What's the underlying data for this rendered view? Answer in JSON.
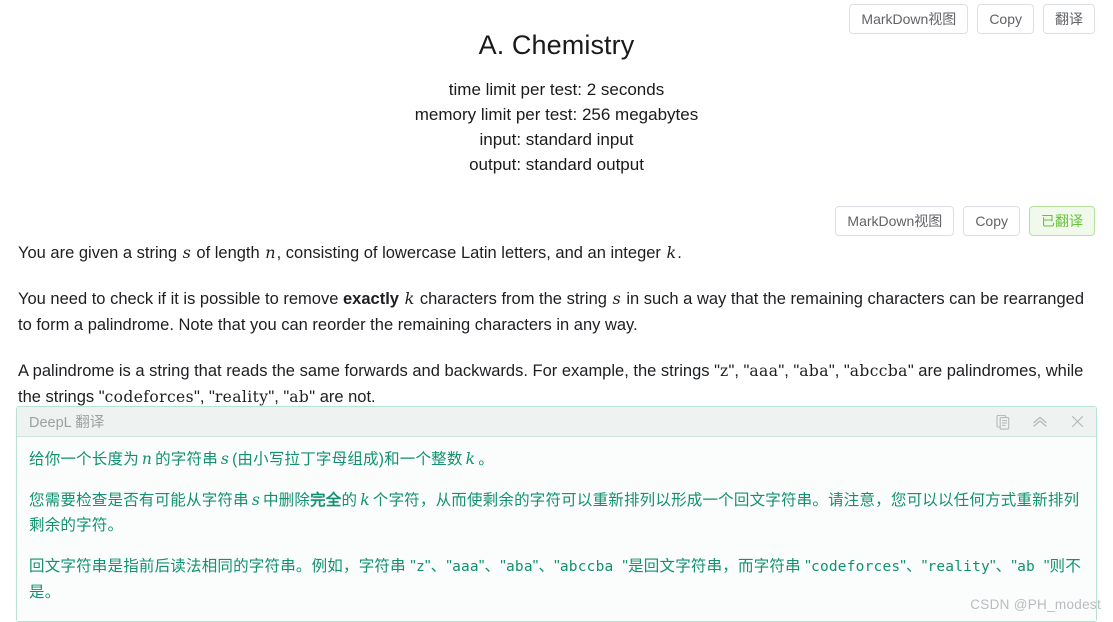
{
  "top_toolbar": {
    "markdown_label": "MarkDown视图",
    "copy_label": "Copy",
    "translate_label": "翻译"
  },
  "statement_toolbar": {
    "markdown_label": "MarkDown视图",
    "copy_label": "Copy",
    "translated_label": "已翻译",
    "translated_color": "#67c23a",
    "translated_bg": "#f0f9eb",
    "translated_border": "#b3e19d"
  },
  "problem": {
    "title": "A. Chemistry",
    "time_limit": "time limit per test: 2 seconds",
    "memory_limit": "memory limit per test: 256 megabytes",
    "input": "input: standard input",
    "output": "output: standard output"
  },
  "statement": {
    "p1": {
      "t1": "You are given a string ",
      "v1": "s",
      "t2": " of length ",
      "v2": "n",
      "t3": ", consisting of lowercase Latin letters, and an integer ",
      "v3": "k",
      "t4": "."
    },
    "p2": {
      "t1": "You need to check if it is possible to remove ",
      "bold": "exactly",
      "t2": " ",
      "v1": "k",
      "t3": " characters from the string ",
      "v2": "s",
      "t4": " in such a way that the remaining characters can be rearranged to form a palindrome. Note that you can reorder the remaining characters in any way."
    },
    "p3": {
      "t1": "A palindrome is a string that reads the same forwards and backwards. For example, the strings \"",
      "s1": "z",
      "t2": "\", \"",
      "s2": "aaa",
      "t3": "\", \"",
      "s3": "aba",
      "t4": "\", \"",
      "s4": "abccba",
      "t5": "\" are palindromes, while the strings \"",
      "s5": "codeforces",
      "t6": "\", \"",
      "s6": "reality",
      "t7": "\", \"",
      "s7": "ab",
      "t8": "\" are not."
    }
  },
  "deepl_panel": {
    "title": "DeepL 翻译",
    "icons": {
      "copy": "copy-icon",
      "collapse": "chevron-up-icon",
      "close": "close-icon"
    },
    "text_color": "#12916f",
    "border_color": "#b9e2d2",
    "header_bg": "#eef2f1",
    "p1": {
      "t1": "给你一个长度为",
      "v1": "n",
      "t2": "的字符串",
      "v2": "s",
      "t3": "(由小写拉丁字母组成)和一个整数",
      "v3": "k",
      "t4": "。"
    },
    "p2": {
      "t1": "您需要检查是否有可能从字符串",
      "v1": "s",
      "t2": "中删除",
      "bold": "完全",
      "t3": "的",
      "v2": "k",
      "t4": "个字符，从而使剩余的字符可以重新排列以形成一个回文字符串。请注意，您可以以任何方式重新排列剩余的字符。"
    },
    "p3": {
      "t1": "回文字符串是指前后读法相同的字符串。例如，字符串 \"",
      "s1": "z",
      "t2": "\"、\"",
      "s2": "aaa",
      "t3": "\"、\"",
      "s3": "aba",
      "t4": "\"、\"",
      "s4": "abccba ",
      "t5": "\"是回文字符串，而字符串 \"",
      "s5": "codeforces",
      "t6": "\"、\"",
      "s6": "reality",
      "t7": "\"、\"",
      "s7": "ab ",
      "t8": "\"则不是。"
    }
  },
  "watermark": "CSDN @PH_modest"
}
